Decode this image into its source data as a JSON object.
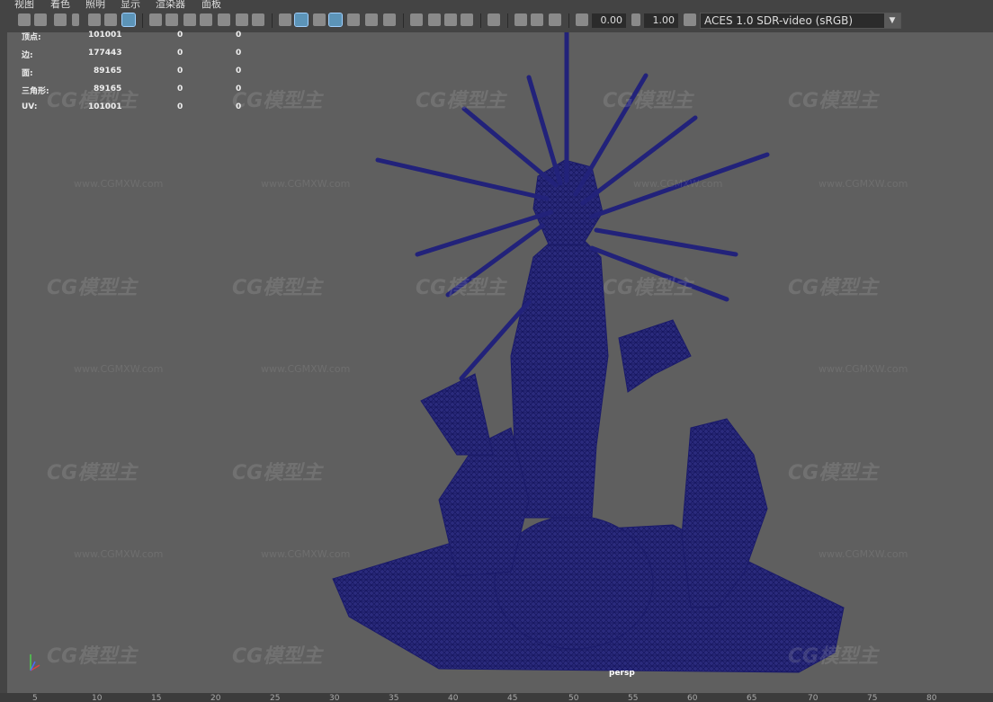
{
  "menu": [
    "视图",
    "着色",
    "照明",
    "显示",
    "渲染器",
    "面板"
  ],
  "toolbar": {
    "field_a": "0.00",
    "field_b": "1.00",
    "color_space": "ACES 1.0 SDR-video (sRGB)"
  },
  "hud": {
    "rows": [
      {
        "label": "顶点:",
        "v1": "101001",
        "v2": "0",
        "v3": "0"
      },
      {
        "label": "边:",
        "v1": "177443",
        "v2": "0",
        "v3": "0"
      },
      {
        "label": "面:",
        "v1": "89165",
        "v2": "0",
        "v3": "0"
      },
      {
        "label": "三角形:",
        "v1": "89165",
        "v2": "0",
        "v3": "0"
      },
      {
        "label": "UV:",
        "v1": "101001",
        "v2": "0",
        "v3": "0"
      }
    ]
  },
  "viewport": {
    "camera": "persp",
    "watermark": "CG模型主",
    "watermark_url": "www.CGMXW.com",
    "mesh_color": "#1a1a8c"
  },
  "timeline": [
    "5",
    "10",
    "15",
    "20",
    "25",
    "30",
    "35",
    "40",
    "45",
    "50",
    "55",
    "60",
    "65",
    "70",
    "75",
    "80"
  ]
}
